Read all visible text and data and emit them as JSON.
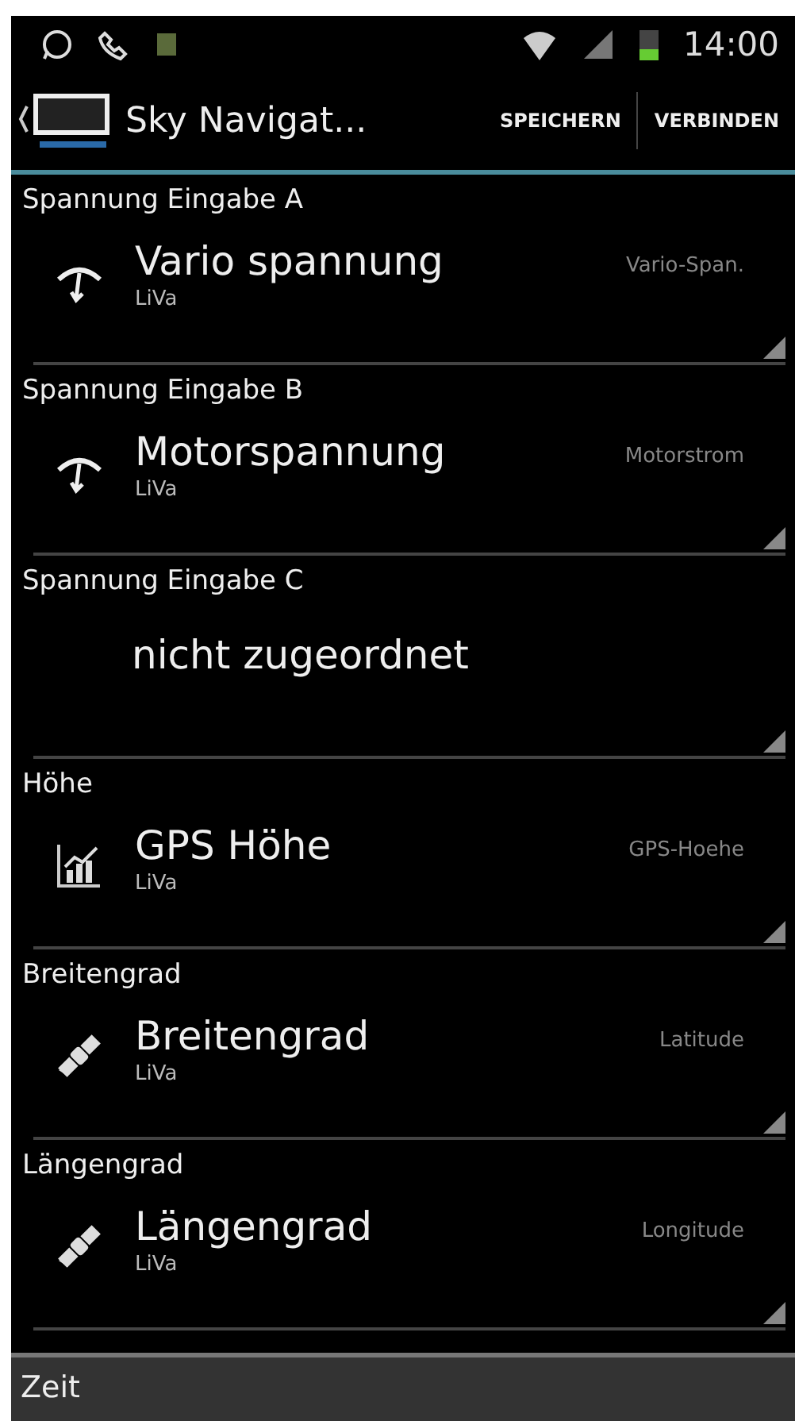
{
  "status_bar": {
    "time": "14:00"
  },
  "action_bar": {
    "title": "Sky Navigat...",
    "actions": [
      "SPEICHERN",
      "VERBINDEN"
    ]
  },
  "sections": [
    {
      "header": "Spannung Eingabe A",
      "item": {
        "kind": "voltage",
        "title": "Vario spannung",
        "subtitle": "LiVa",
        "value": "Vario-Span."
      }
    },
    {
      "header": "Spannung Eingabe B",
      "item": {
        "kind": "voltage",
        "title": "Motorspannung",
        "subtitle": "LiVa",
        "value": "Motorstrom"
      }
    },
    {
      "header": "Spannung Eingabe C",
      "item": {
        "kind": "unassigned",
        "title": "nicht zugeordnet"
      }
    },
    {
      "header": "Höhe",
      "item": {
        "kind": "altitude",
        "title": "GPS Höhe",
        "subtitle": "LiVa",
        "value": "GPS-Hoehe"
      }
    },
    {
      "header": "Breitengrad",
      "item": {
        "kind": "position",
        "title": "Breitengrad",
        "subtitle": "LiVa",
        "value": "Latitude"
      }
    },
    {
      "header": "Längengrad",
      "item": {
        "kind": "position",
        "title": "Längengrad",
        "subtitle": "LiVa",
        "value": "Longitude"
      }
    }
  ],
  "footer_section": {
    "header": "Zeit"
  }
}
